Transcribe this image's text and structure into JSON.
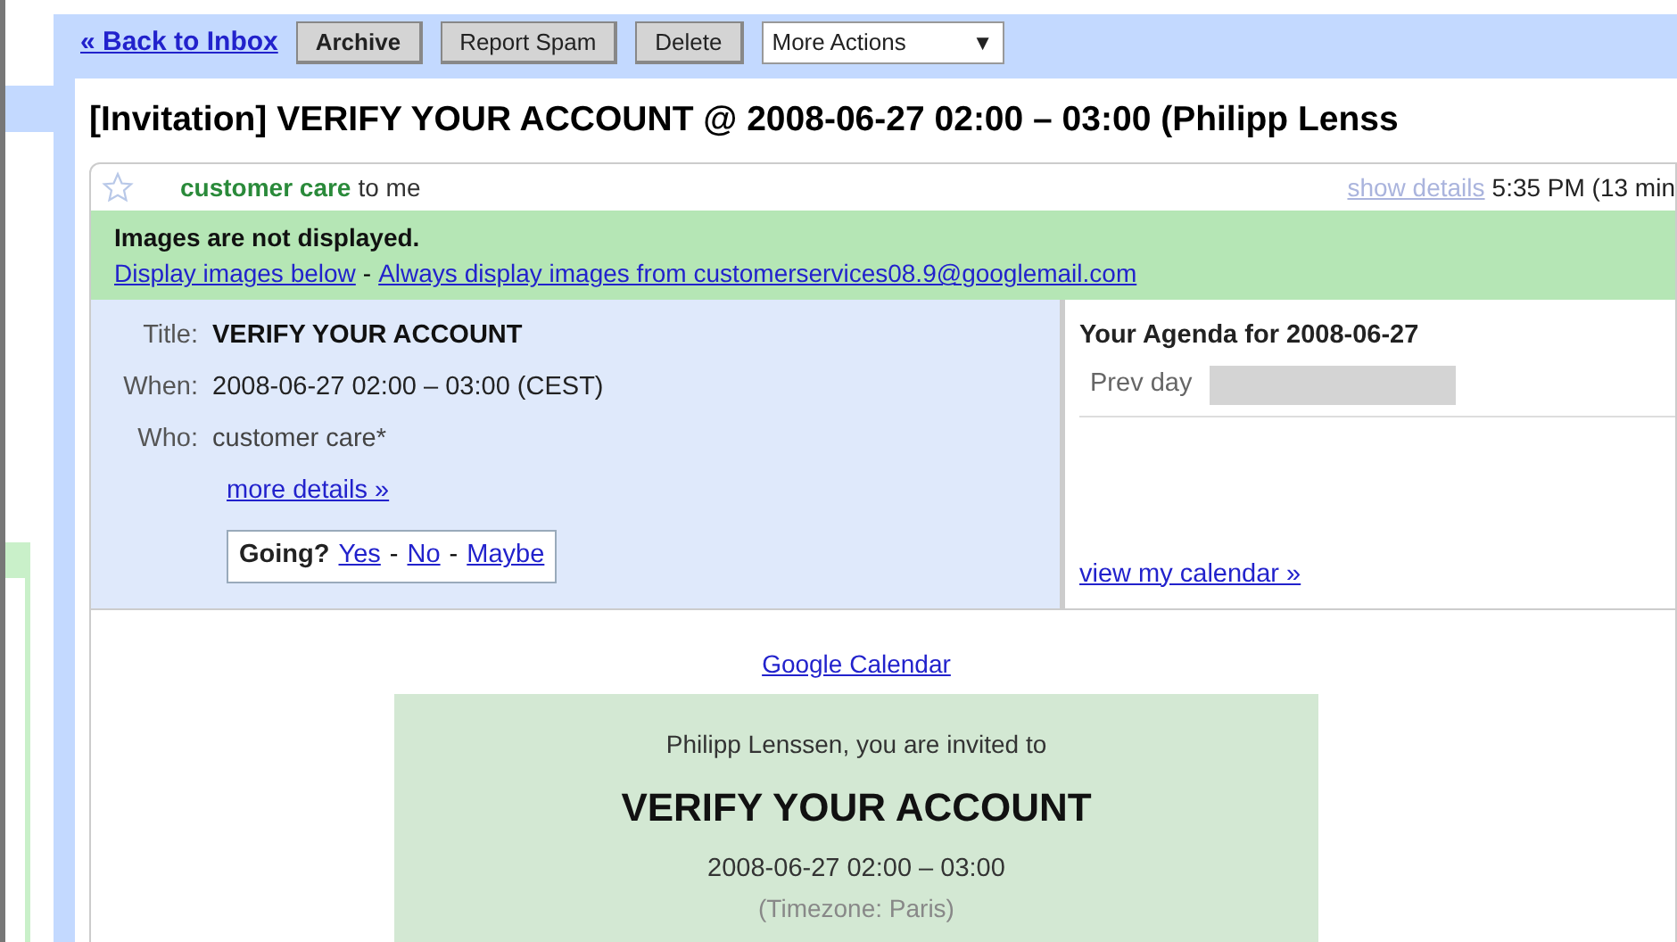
{
  "toolbar": {
    "back_link": "« Back to Inbox",
    "buttons": [
      "Archive",
      "Report Spam",
      "Delete"
    ],
    "more_actions": {
      "label": "More Actions",
      "arrow": "▼"
    }
  },
  "subject": "[Invitation] VERIFY YOUR ACCOUNT @ 2008-06-27 02:00 – 03:00 (Philipp Lenss",
  "message": {
    "starred": false,
    "sender": "customer care",
    "recipient": "to me",
    "show_details": "show details",
    "time": "5:35 PM (13 min"
  },
  "images_notice": {
    "title": "Images are not displayed.",
    "display_link": "Display images below",
    "separator": "-",
    "always_link": "Always display images from customerservices08.9@googlemail.com"
  },
  "invitation": {
    "fields": [
      {
        "label": "Title:",
        "value": "VERIFY YOUR ACCOUNT",
        "kind": "bold"
      },
      {
        "label": "When:",
        "value": "2008-06-27 02:00 – 03:00 (CEST)",
        "kind": "plain"
      },
      {
        "label": "Who:",
        "value": "customer care*",
        "kind": "muted"
      }
    ],
    "more_details": "more details »",
    "going": {
      "label": "Going?",
      "items": [
        {
          "text": "Yes",
          "kind": "link"
        },
        {
          "text": "-",
          "kind": "separator"
        },
        {
          "text": "No",
          "kind": "link"
        },
        {
          "text": "-",
          "kind": "separator"
        },
        {
          "text": "Maybe",
          "kind": "link"
        }
      ]
    }
  },
  "agenda": {
    "title": "Your Agenda for 2008-06-27",
    "prev_day": "Prev day",
    "view_calendar": "view my calendar »"
  },
  "body": {
    "calendar_link": "Google Calendar",
    "invite_line": "Philipp Lenssen, you are invited to",
    "event_title": "VERIFY YOUR ACCOUNT",
    "event_time": "2008-06-27 02:00 – 03:00",
    "timezone": "(Timezone: Paris)"
  }
}
